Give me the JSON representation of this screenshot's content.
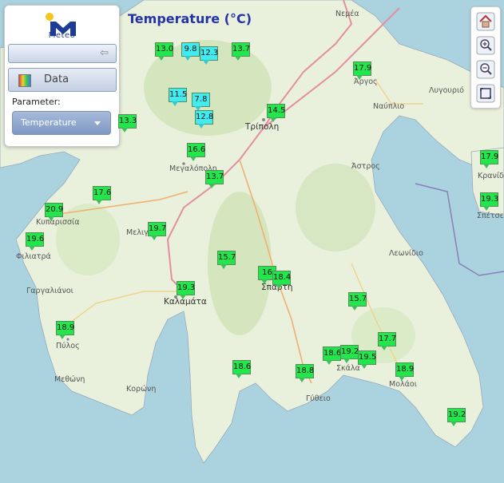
{
  "panel": {
    "logo_text": "Meteo",
    "data_label": "Data",
    "parameter_label": "Parameter:",
    "parameter_value": "Temperature"
  },
  "map_title": "Temperature (°C)",
  "colors": {
    "green": "#22e64c",
    "cyan": "#40ecf0",
    "water": "#aad3df",
    "land": "#f2efe9",
    "title": "#2433a8"
  },
  "toolbar": [
    "home-icon",
    "zoom-in-icon",
    "zoom-out-icon",
    "zoom-extent-icon"
  ],
  "places": [
    "Νεμέα",
    "Άργος",
    "Λυγουριό",
    "Ναύπλιο",
    "Τρίπολη",
    "Μεγαλόπολη",
    "Άστρος",
    "Κρανίδ",
    "Σπέτσε",
    "Κυπαρισσία",
    "Μελιγ",
    "Φιλιατρά",
    "Λεωνίδιο",
    "Γαργαλιάνοι",
    "Καλαμάτα",
    "Σπάρτη",
    "Πύλος",
    "Σκάλα",
    "Μεθώνη",
    "Κορώνη",
    "Γύθειο",
    "Μολάοι"
  ],
  "stations": [
    {
      "value": "13.0",
      "kind": "green"
    },
    {
      "value": "9.8",
      "kind": "cyan"
    },
    {
      "value": "12.3",
      "kind": "cyan"
    },
    {
      "value": "13.7",
      "kind": "green"
    },
    {
      "value": "17.9",
      "kind": "green"
    },
    {
      "value": "11.5",
      "kind": "cyan"
    },
    {
      "value": "7.8",
      "kind": "cyan"
    },
    {
      "value": "12.8",
      "kind": "cyan"
    },
    {
      "value": "14.5",
      "kind": "green"
    },
    {
      "value": "13.3",
      "kind": "green"
    },
    {
      "value": "16.6",
      "kind": "green"
    },
    {
      "value": "13.7",
      "kind": "green"
    },
    {
      "value": "17.6",
      "kind": "green"
    },
    {
      "value": "17.9",
      "kind": "green"
    },
    {
      "value": "19.3",
      "kind": "green"
    },
    {
      "value": "20.9",
      "kind": "green"
    },
    {
      "value": "19.7",
      "kind": "green"
    },
    {
      "value": "19.6",
      "kind": "green"
    },
    {
      "value": "15.7",
      "kind": "green"
    },
    {
      "value": "16",
      "kind": "green"
    },
    {
      "value": "18.4",
      "kind": "green"
    },
    {
      "value": "19.3",
      "kind": "green"
    },
    {
      "value": "15.7",
      "kind": "green"
    },
    {
      "value": "18.9",
      "kind": "green"
    },
    {
      "value": "17.7",
      "kind": "green"
    },
    {
      "value": "18.6",
      "kind": "green"
    },
    {
      "value": "19.2",
      "kind": "green"
    },
    {
      "value": "19.5",
      "kind": "green"
    },
    {
      "value": "18.6",
      "kind": "green"
    },
    {
      "value": "18.8",
      "kind": "green"
    },
    {
      "value": "18.9",
      "kind": "green"
    },
    {
      "value": "19.2",
      "kind": "green"
    }
  ]
}
